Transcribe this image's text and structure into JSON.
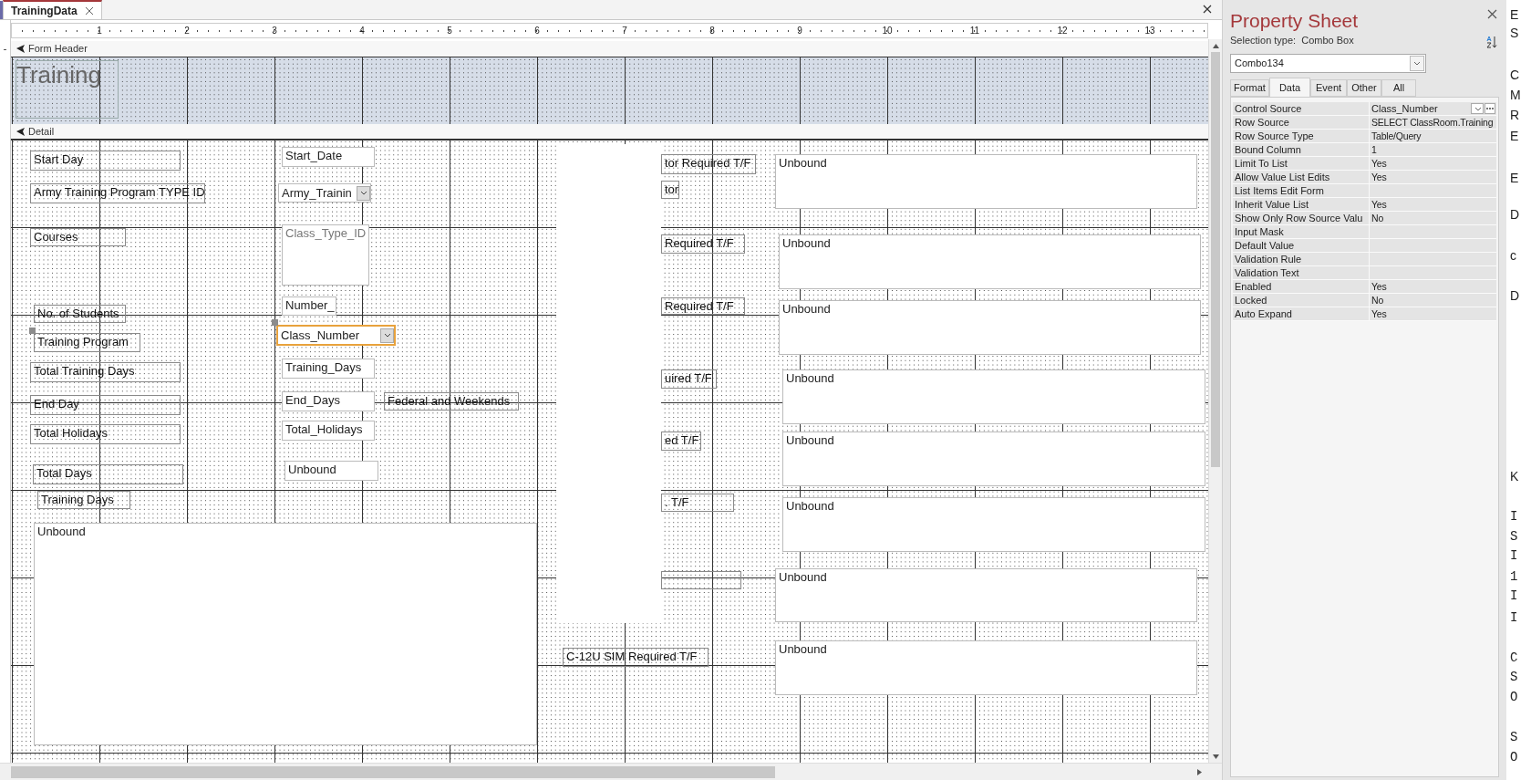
{
  "document_tab": {
    "title": "TrainingData"
  },
  "ruler": {
    "marks": [
      "1",
      "2",
      "3",
      "4",
      "5",
      "6",
      "7",
      "8",
      "9",
      "10",
      "11",
      "12",
      "13"
    ]
  },
  "form_header": {
    "title": "Form Header",
    "controls": [
      {
        "kind": "title",
        "text": "Training",
        "selected": false
      }
    ]
  },
  "detail": {
    "title": "Detail",
    "controls": [
      {
        "kind": "label",
        "text": "Start Day",
        "selected": false,
        "handle": false
      },
      {
        "kind": "textbox",
        "text": "Start_Date",
        "selected": false,
        "handle": false
      },
      {
        "kind": "label",
        "text": "Army Training Program TYPE ID",
        "selected": false,
        "handle": false
      },
      {
        "kind": "combo",
        "text": "Army_Trainin",
        "selected": false,
        "handle": false
      },
      {
        "kind": "label",
        "text": "Courses",
        "selected": false,
        "handle": false
      },
      {
        "kind": "listbox",
        "text": "Class_Type_ID",
        "selected": false,
        "handle": false
      },
      {
        "kind": "textbox",
        "text": "Number_",
        "selected": false,
        "handle": false
      },
      {
        "kind": "label",
        "text": "No. of Students",
        "selected": false,
        "handle": false
      },
      {
        "kind": "combo",
        "text": "Class_Number",
        "selected": true,
        "handle": true
      },
      {
        "kind": "label",
        "text": "Training Program",
        "selected": false,
        "handle": true
      },
      {
        "kind": "label",
        "text": "Total Training Days",
        "selected": false,
        "handle": false
      },
      {
        "kind": "textbox",
        "text": "Training_Days",
        "selected": false,
        "handle": false
      },
      {
        "kind": "label",
        "text": "End Day",
        "selected": false,
        "handle": false
      },
      {
        "kind": "textbox",
        "text": "End_Days",
        "selected": false,
        "handle": false
      },
      {
        "kind": "label",
        "text": "Federal and Weekends",
        "selected": false,
        "handle": false
      },
      {
        "kind": "label",
        "text": "Total Holidays",
        "selected": false,
        "handle": false
      },
      {
        "kind": "textbox",
        "text": "Total_Holidays",
        "selected": false,
        "handle": false
      },
      {
        "kind": "label",
        "text": "Total Days",
        "selected": false,
        "handle": false
      },
      {
        "kind": "textbox",
        "text": "Unbound",
        "selected": false,
        "handle": false
      },
      {
        "kind": "label",
        "text": "Training Days",
        "selected": false,
        "handle": false
      },
      {
        "kind": "textbox",
        "text": "Unbound",
        "selected": false,
        "handle": false
      },
      {
        "kind": "label",
        "text": "tor Required T/F",
        "selected": false,
        "handle": false
      },
      {
        "kind": "label",
        "text": "tor",
        "selected": false,
        "handle": false
      },
      {
        "kind": "textbox",
        "text": "Unbound",
        "selected": false,
        "handle": false
      },
      {
        "kind": "label",
        "text": "Required T/F",
        "selected": false,
        "handle": false
      },
      {
        "kind": "textbox",
        "text": "Unbound",
        "selected": false,
        "handle": false
      },
      {
        "kind": "label",
        "text": "Required T/F",
        "selected": false,
        "handle": false
      },
      {
        "kind": "textbox",
        "text": "Unbound",
        "selected": false,
        "handle": false
      },
      {
        "kind": "label",
        "text": "uired T/F",
        "selected": false,
        "handle": false
      },
      {
        "kind": "textbox",
        "text": "Unbound",
        "selected": false,
        "handle": false
      },
      {
        "kind": "label",
        "text": "ed T/F",
        "selected": false,
        "handle": false
      },
      {
        "kind": "textbox",
        "text": "Unbound",
        "selected": false,
        "handle": false
      },
      {
        "kind": "label",
        "text": ". T/F",
        "selected": false,
        "handle": false
      },
      {
        "kind": "textbox",
        "text": "Unbound",
        "selected": false,
        "handle": false
      },
      {
        "kind": "textbox",
        "text": "Unbound",
        "selected": false,
        "handle": false
      },
      {
        "kind": "label",
        "text": "C-12U SIM Required T/F",
        "selected": false,
        "handle": false
      },
      {
        "kind": "textbox",
        "text": "Unbound",
        "selected": false,
        "handle": false
      }
    ]
  },
  "property_sheet": {
    "title": "Property Sheet",
    "selection_type": "Selection type:  Combo Box",
    "object": "Combo134",
    "tabs": [
      {
        "label": "Format",
        "selected": false
      },
      {
        "label": "Data",
        "selected": true
      },
      {
        "label": "Event",
        "selected": false
      },
      {
        "label": "Other",
        "selected": false
      },
      {
        "label": "All",
        "selected": false
      }
    ],
    "properties": [
      {
        "kind": "dropdown",
        "name": "Control Source",
        "value": "Class_Number"
      },
      {
        "kind": "text",
        "name": "Row Source",
        "value": "SELECT ClassRoom.Training"
      },
      {
        "kind": "text",
        "name": "Row Source Type",
        "value": "Table/Query"
      },
      {
        "kind": "text",
        "name": "Bound Column",
        "value": "1"
      },
      {
        "kind": "text",
        "name": "Limit To List",
        "value": "Yes"
      },
      {
        "kind": "text",
        "name": "Allow Value List Edits",
        "value": "Yes"
      },
      {
        "kind": "text",
        "name": "List Items Edit Form"
      },
      {
        "kind": "text",
        "name": "Inherit Value List",
        "value": "Yes"
      },
      {
        "kind": "text",
        "name": "Show Only Row Source Valu",
        "value": "No"
      },
      {
        "kind": "text",
        "name": "Input Mask"
      },
      {
        "kind": "text",
        "name": "Default Value"
      },
      {
        "kind": "text",
        "name": "Validation Rule"
      },
      {
        "kind": "text",
        "name": "Validation Text"
      },
      {
        "kind": "text",
        "name": "Enabled",
        "value": "Yes"
      },
      {
        "kind": "text",
        "name": "Locked",
        "value": "No"
      },
      {
        "kind": "text",
        "name": "Auto Expand",
        "value": "Yes"
      }
    ]
  },
  "side_text": [
    "E",
    "S",
    "C",
    "M",
    "R",
    "E",
    "E",
    "D",
    "c",
    "D",
    "K",
    "I",
    "S",
    "I",
    "1",
    "I",
    "I",
    "C",
    "S",
    "O",
    "S",
    "O"
  ]
}
